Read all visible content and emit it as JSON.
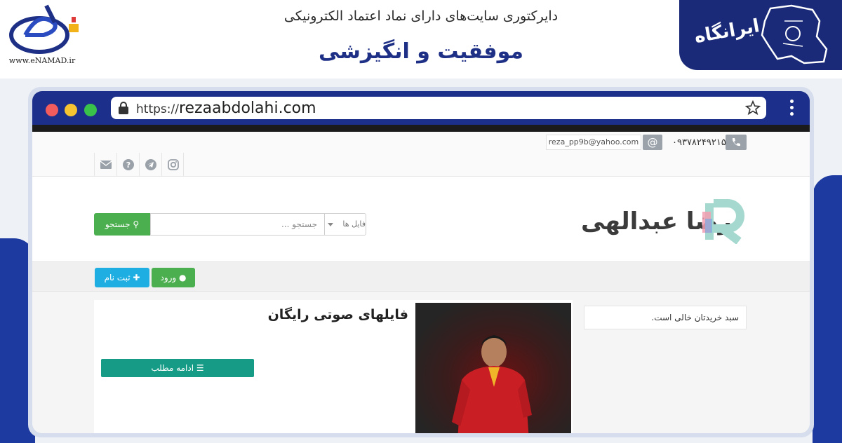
{
  "banner": {
    "enamad_url": "www.eNAMAD.ir",
    "subtitle": "دایرکتوری سایت‌های دارای نماد اعتماد الکترونیکی",
    "title": "موفقیت و انگیزشی",
    "brand_text": "ایرانگاه"
  },
  "browser": {
    "url_protocol": "https://",
    "url_domain": "rezaabdolahi.com"
  },
  "site": {
    "phone": "۰۹۳۷۸۲۴۹۲۱۵",
    "at_symbol": "@",
    "email": "reza_pp9b@yahoo.com",
    "social_icons": [
      "instagram-icon",
      "telegram-icon",
      "question-icon",
      "mail-icon"
    ],
    "search": {
      "button_label": "جستجو",
      "placeholder": "جستجو ...",
      "select_value": "فایل ها"
    },
    "logo_text": "رضا عبدالهی",
    "nav": {
      "register_label": "ثبت نام",
      "login_label": "ورود"
    },
    "post": {
      "title": "فایلهای صوتی رایگان",
      "more_label": "ادامه مطلب"
    },
    "cart_text": "سبد خریدتان خالی است."
  },
  "colors": {
    "brand_navy": "#1c2f8a",
    "green": "#4bae4f",
    "cyan": "#1eaee2",
    "teal": "#169c86"
  }
}
